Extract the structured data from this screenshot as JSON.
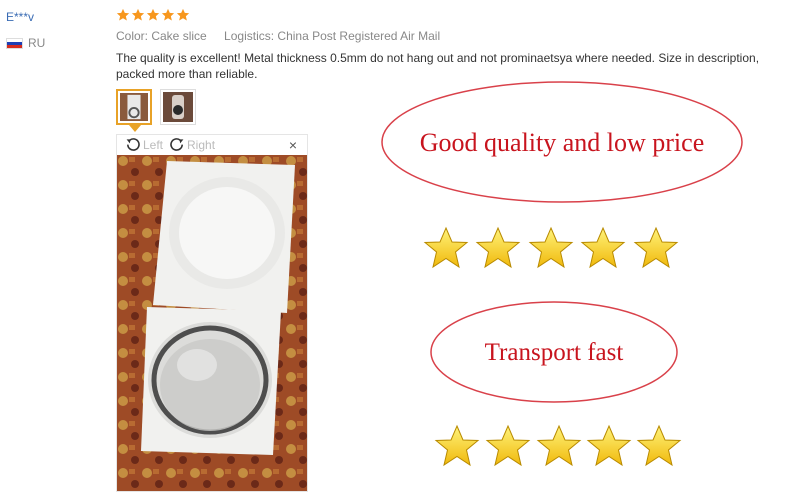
{
  "reviewer": {
    "name": "E***v",
    "country": "RU",
    "flag_colors": [
      "#ffffff",
      "#1c3fb5",
      "#d52b1e"
    ]
  },
  "rating": {
    "stars": 5,
    "max": 5,
    "color": "#f7971e"
  },
  "meta": {
    "color": "Color: Cake slice",
    "logistics": "Logistics: China Post Registered Air Mail"
  },
  "review": {
    "text": "The quality is excellent! Metal thickness 0.5mm do not hang out and not prominaetsya where needed. Size in description, packed more than reliable."
  },
  "viewer": {
    "rotate_left": "Left",
    "rotate_right": "Right",
    "close": "×"
  },
  "ad_image": {
    "line1": "Good quality and low price",
    "line2": "Transport fast",
    "star_color": "#f5d41c"
  }
}
